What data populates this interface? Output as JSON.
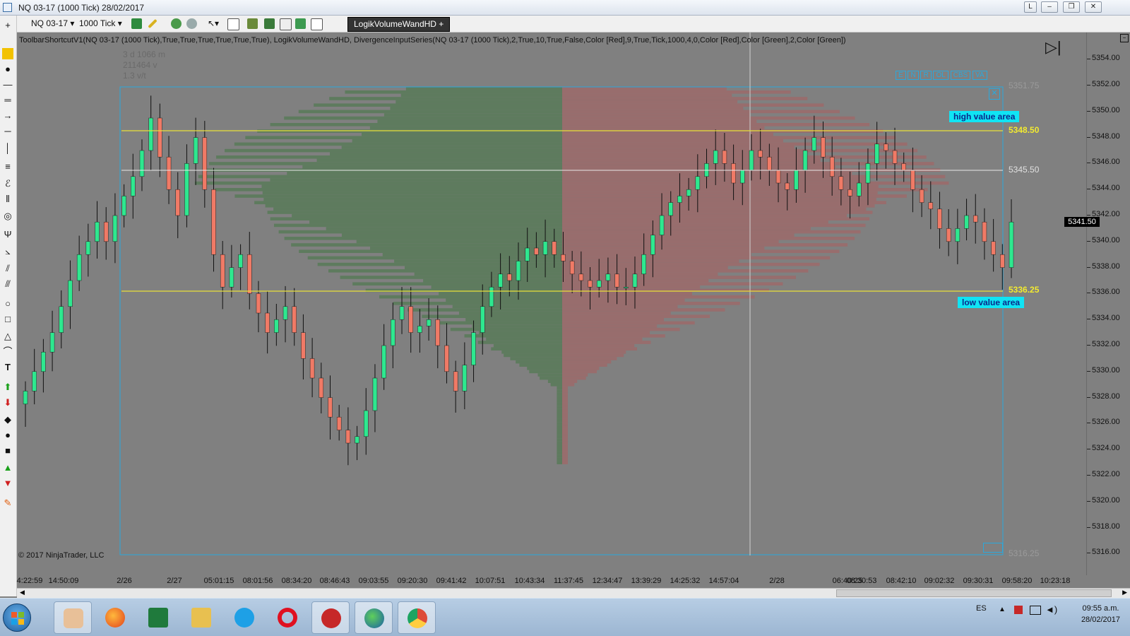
{
  "window": {
    "title": "NQ 03-17 (1000 Tick)  28/02/2017",
    "buttons": [
      "L",
      "–",
      "❐",
      "✕"
    ]
  },
  "toolbar": {
    "instrument": "NQ 03-17",
    "interval": "1000 Tick",
    "indicator_button": "LogikVolumeWandHD +"
  },
  "chart": {
    "indicator_line": "ToolbarShortcutV1(NQ 03-17 (1000 Tick),True,True,True,True,True,True), LogikVolumeWandHD, DivergenceInputSeries(NQ 03-17 (1000 Tick),2,True,10,True,False,Color [Red],9,True,Tick,1000,4,0,Color [Red],Color [Green],2,Color [Green])",
    "info_lines": [
      "3 d 1066 m",
      "211464 v",
      "1.3 v/t"
    ],
    "copyright": "© 2017 NinjaTrader, LLC",
    "profile_buttons": [
      "E",
      "N",
      "R",
      "OL",
      "CBS",
      "VA"
    ],
    "price_labels": {
      "top": "5351.75",
      "high_value": "5348.50",
      "poc": "5345.50",
      "low_value": "5336.25",
      "bottom": "5316.25",
      "current": "5341.50"
    },
    "high_value_area_label": "high value area",
    "low_value_area_label": "low value area",
    "colors": {
      "up": "#2ee88f",
      "down": "#f07a66",
      "value_line": "#e8e03a",
      "box": "#2aa8dc",
      "label_bg": "#10e4f4",
      "label_text": "#0a2a8c",
      "buy_profile": "#5a7a5a",
      "sell_profile": "#9a6a6a"
    }
  },
  "chart_data": {
    "type": "candlestick",
    "instrument": "NQ 03-17",
    "interval": "1000 Tick",
    "price_range": [
      5316.25,
      5351.75
    ],
    "value_area_high": 5348.5,
    "point_of_control": 5345.5,
    "value_area_low": 5336.25,
    "last_price": 5341.5,
    "y_ticks": [
      "5354.00",
      "5352.00",
      "5350.00",
      "5348.00",
      "5346.00",
      "5344.00",
      "5342.00",
      "5340.00",
      "5338.00",
      "5336.00",
      "5334.00",
      "5332.00",
      "5330.00",
      "5328.00",
      "5326.00",
      "5324.00",
      "5322.00",
      "5320.00",
      "5318.00",
      "5316.00"
    ],
    "x_ticks": [
      "4:22:59",
      "14:50:09",
      "2/26",
      "2/27",
      "05:01:15",
      "08:01:56",
      "08:34:20",
      "08:46:43",
      "09:03:55",
      "09:20:30",
      "09:41:42",
      "10:07:51",
      "10:43:34",
      "11:37:45",
      "12:34:47",
      "13:39:29",
      "14:25:32",
      "14:57:04",
      "2/28",
      "06:40:25",
      "08:30:53",
      "08:42:10",
      "09:02:32",
      "09:30:31",
      "09:58:20",
      "10:23:18"
    ],
    "close_path": [
      5328.5,
      5330,
      5331.5,
      5333,
      5335,
      5337,
      5339,
      5340,
      5341.5,
      5340,
      5342,
      5343.5,
      5345,
      5347,
      5349.5,
      5346.5,
      5344,
      5342,
      5346,
      5348,
      5344,
      5339,
      5336.5,
      5338,
      5339,
      5336,
      5334.5,
      5333,
      5334,
      5335,
      5333,
      5331,
      5329.5,
      5328,
      5326.5,
      5325.5,
      5324.5,
      5325,
      5327,
      5329.5,
      5332,
      5334,
      5335,
      5333,
      5333.5,
      5334,
      5332,
      5330,
      5328.5,
      5330.5,
      5333,
      5335,
      5336.5,
      5337.5,
      5337,
      5338.5,
      5339.5,
      5339,
      5340,
      5339,
      5338.5,
      5337.5,
      5337,
      5336.5,
      5337,
      5337.5,
      5336.5,
      5336.5,
      5337.5,
      5339,
      5340.5,
      5342,
      5343,
      5343.5,
      5344,
      5345,
      5346,
      5347,
      5346,
      5344.5,
      5345.5,
      5347,
      5346.5,
      5345.5,
      5344.5,
      5344,
      5345.5,
      5347,
      5348,
      5346.5,
      5345,
      5344,
      5343.5,
      5344.5,
      5346,
      5347.5,
      5347,
      5346,
      5345.5,
      5344,
      5343,
      5342.5,
      5341,
      5340,
      5341,
      5342,
      5341.5,
      5340,
      5339,
      5338,
      5341.5
    ]
  },
  "xaxis_ticks": [
    "4:22:59",
    "14:50:09",
    "2/26",
    "2/27",
    "05:01:15",
    "08:01:56",
    "08:34:20",
    "08:46:43",
    "09:03:55",
    "09:20:30",
    "09:41:42",
    "10:07:51",
    "10:43:34",
    "11:37:45",
    "12:34:47",
    "13:39:29",
    "14:25:32",
    "14:57:04",
    "2/28",
    "06:40:25",
    "08:30:53",
    "08:42:10",
    "09:02:32",
    "09:30:31",
    "09:58:20",
    "10:23:18"
  ],
  "taskbar": {
    "language": "ES",
    "time": "09:55 a.m.",
    "date": "28/02/2017",
    "apps": [
      "hand-tool-icon",
      "firefox-icon",
      "excel-icon",
      "folder-icon",
      "skype-icon",
      "opera-icon",
      "ninjatrader-icon",
      "globe-icon",
      "chrome-icon"
    ]
  }
}
